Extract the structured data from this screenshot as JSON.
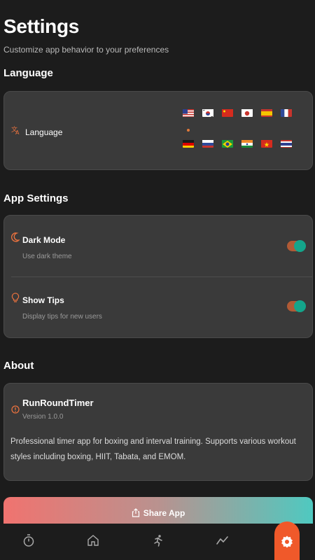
{
  "header": {
    "title": "Settings",
    "subtitle": "Customize app behavior to your preferences"
  },
  "language_section": {
    "title": "Language",
    "label": "Language",
    "icon": "translate-icon",
    "flags": [
      "us",
      "kr",
      "cn",
      "jp",
      "es",
      "fr",
      "de",
      "ru",
      "br",
      "in",
      "vn",
      "th"
    ],
    "selected": "us"
  },
  "app_settings": {
    "title": "App Settings",
    "items": [
      {
        "name": "Dark Mode",
        "desc": "Use dark theme",
        "icon": "moon-icon",
        "enabled": true
      },
      {
        "name": "Show Tips",
        "desc": "Display tips for new users",
        "icon": "lightbulb-icon",
        "enabled": true
      }
    ]
  },
  "about": {
    "title": "About",
    "app_name": "RunRoundTimer",
    "version": "Version 1.0.0",
    "description": "Professional timer app for boxing and interval training. Supports various workout styles including boxing, HIIT, Tabata, and EMOM."
  },
  "share": {
    "label": "Share App",
    "icon": "share-icon"
  },
  "tabbar": {
    "tabs": [
      "timer-icon",
      "home-icon",
      "runner-icon",
      "stats-icon",
      "settings-icon"
    ],
    "active": "settings-icon"
  },
  "colors": {
    "background": "#1c1c1c",
    "card": "#3a3a3a",
    "accent": "#f0592a",
    "toggle_track": "#b05a35",
    "toggle_knob": "#14a58b"
  }
}
